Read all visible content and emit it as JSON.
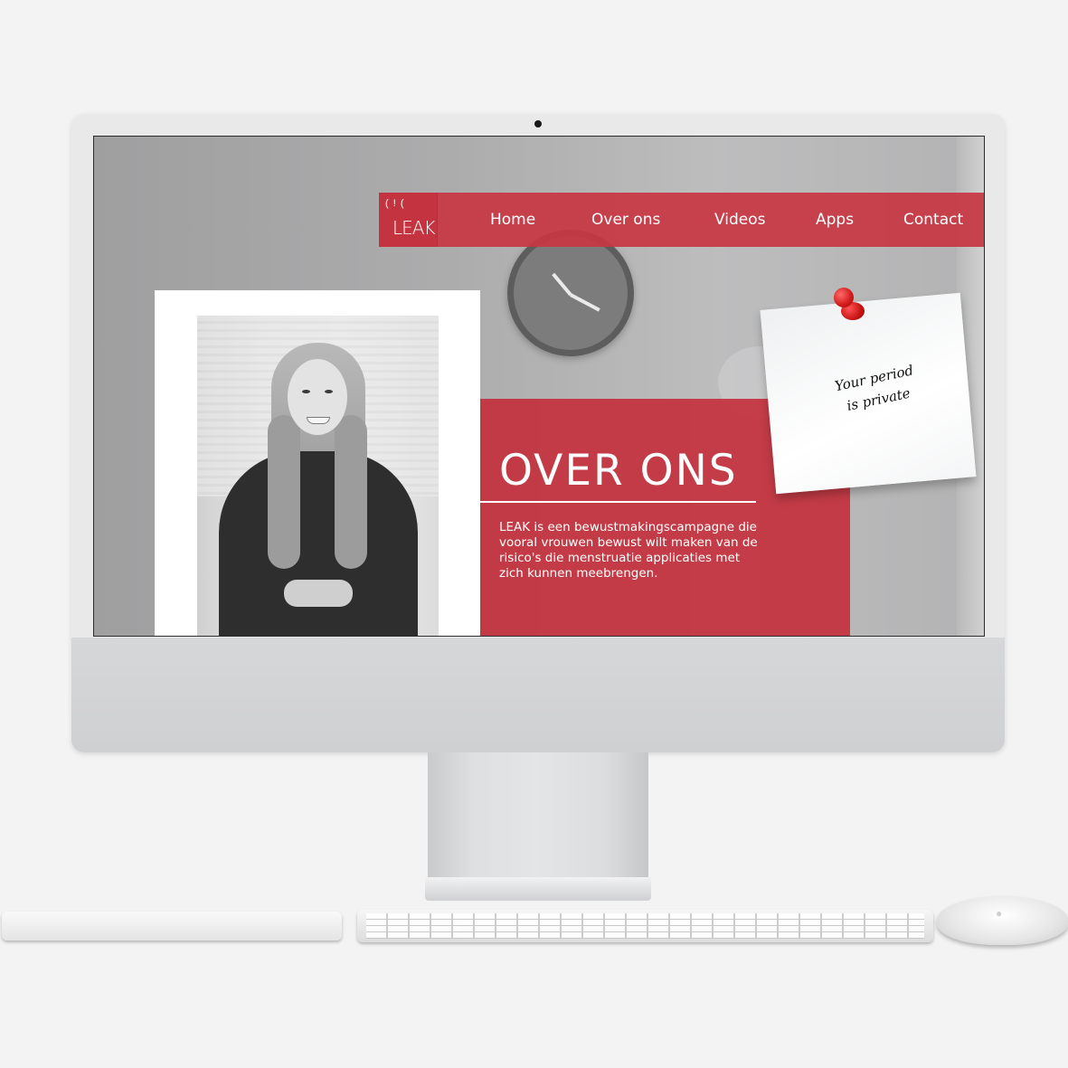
{
  "site": {
    "logo": {
      "mark": "( ! (",
      "text": "LEAK"
    },
    "nav": {
      "items": [
        {
          "label": "Home"
        },
        {
          "label": "Over ons"
        },
        {
          "label": "Videos"
        },
        {
          "label": "Apps"
        },
        {
          "label": "Contact"
        }
      ]
    },
    "section": {
      "title": "OVER ONS",
      "body": "LEAK is een bewustmakingscampagne die vooral vrouwen bewust wilt maken van de risico's die menstruatie applicaties met zich kunnen meebrengen."
    },
    "note": {
      "line1": "Your period",
      "line2": "is private"
    }
  },
  "colors": {
    "brand_red": "#c33440",
    "background": "#f3f3f3",
    "nav_text": "#ffffff"
  },
  "icons": {
    "pin": "pushpin-icon",
    "apple": "apple-logo-icon"
  }
}
